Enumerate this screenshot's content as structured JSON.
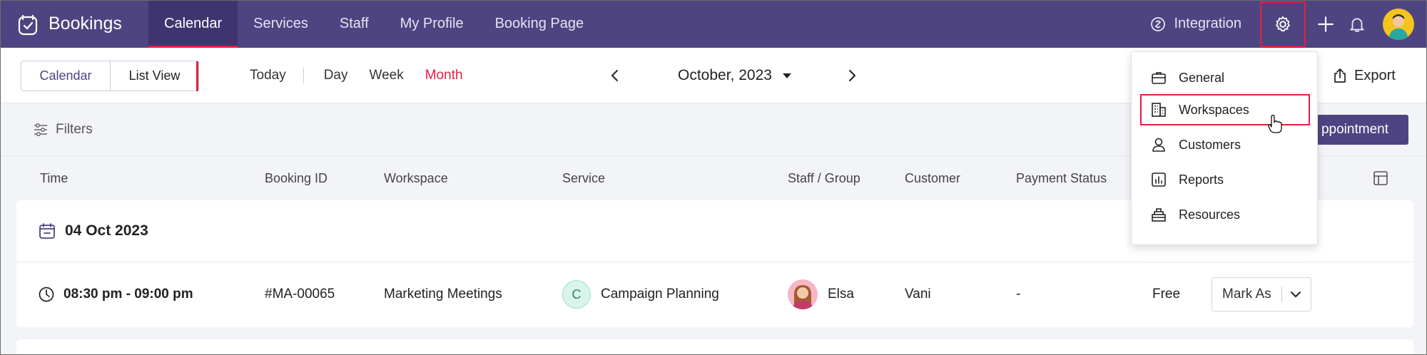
{
  "topbar": {
    "brand": "Bookings",
    "nav": [
      "Calendar",
      "Services",
      "Staff",
      "My Profile",
      "Booking Page"
    ],
    "integration": "Integration"
  },
  "toolbar": {
    "view_calendar": "Calendar",
    "view_list": "List View",
    "range": {
      "today": "Today",
      "day": "Day",
      "week": "Week",
      "month": "Month"
    },
    "month_label": "October, 2023",
    "export": "Export"
  },
  "filters": {
    "label": "Filters",
    "new_appointment": "ppointment"
  },
  "table": {
    "headers": [
      "Time",
      "Booking ID",
      "Workspace",
      "Service",
      "Staff / Group",
      "Customer",
      "Payment Status"
    ],
    "group_date": "04 Oct 2023",
    "row": {
      "time": "08:30 pm - 09:00 pm",
      "booking_id": "#MA-00065",
      "workspace": "Marketing Meetings",
      "service_initial": "C",
      "service": "Campaign Planning",
      "staff": "Elsa",
      "customer": "Vani",
      "payment_status": "-",
      "price": "Free",
      "action": "Mark As"
    }
  },
  "settings_menu": {
    "items": [
      "General",
      "Workspaces",
      "Customers",
      "Reports",
      "Resources"
    ],
    "highlighted": "Workspaces"
  },
  "colors": {
    "topbar": "#4e4481",
    "accent_red": "#e3203f",
    "avatar_yellow": "#f3c41c"
  }
}
